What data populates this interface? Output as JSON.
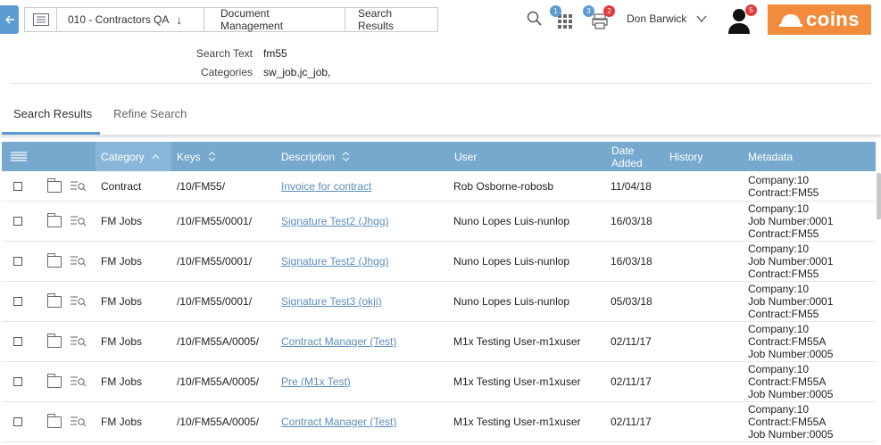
{
  "topbar": {
    "breadcrumbs": [
      {
        "label": "010 - Contractors QA",
        "arrow": "↓"
      },
      {
        "label": "Document Management"
      },
      {
        "label": "Search Results"
      }
    ],
    "badges": {
      "grid": "1",
      "notifications_blue": "3",
      "notifications_red": "2",
      "profile": "5"
    },
    "user_name": "Don Barwick",
    "logo_text": "coins"
  },
  "criteria": {
    "search_text_label": "Search Text",
    "search_text_value": "fm55",
    "categories_label": "Categories",
    "categories_value": "sw_job,jc_job,"
  },
  "tabs": [
    {
      "label": "Search Results",
      "active": true
    },
    {
      "label": "Refine Search",
      "active": false
    }
  ],
  "table": {
    "headers": {
      "category": "Category",
      "keys": "Keys",
      "description": "Description",
      "user": "User",
      "date_added_1": "Date",
      "date_added_2": "Added",
      "history": "History",
      "metadata": "Metadata"
    },
    "rows": [
      {
        "category": "Contract",
        "keys": "/10/FM55/",
        "description": "Invoice for contract",
        "user": "Rob Osborne-robosb",
        "date": "11/04/18",
        "history": "",
        "meta": [
          "Company:10",
          "Contract:FM55"
        ]
      },
      {
        "category": "FM Jobs",
        "keys": "/10/FM55/0001/",
        "description": "Signature Test2 (Jhgg)",
        "user": "Nuno Lopes Luis-nunlop",
        "date": "16/03/18",
        "history": "",
        "meta": [
          "Company:10",
          "Job Number:0001",
          "Contract:FM55"
        ]
      },
      {
        "category": "FM Jobs",
        "keys": "/10/FM55/0001/",
        "description": "Signature Test2 (Jhgg)",
        "user": "Nuno Lopes Luis-nunlop",
        "date": "16/03/18",
        "history": "",
        "meta": [
          "Company:10",
          "Job Number:0001",
          "Contract:FM55"
        ]
      },
      {
        "category": "FM Jobs",
        "keys": "/10/FM55/0001/",
        "description": "Signature Test3 (okji)",
        "user": "Nuno Lopes Luis-nunlop",
        "date": "05/03/18",
        "history": "",
        "meta": [
          "Company:10",
          "Job Number:0001",
          "Contract:FM55"
        ]
      },
      {
        "category": "FM Jobs",
        "keys": "/10/FM55A/0005/",
        "description": "Contract Manager (Test)",
        "user": "M1x Testing User-m1xuser",
        "date": "02/11/17",
        "history": "",
        "meta": [
          "Company:10",
          "Contract:FM55A",
          "Job Number:0005"
        ]
      },
      {
        "category": "FM Jobs",
        "keys": "/10/FM55A/0005/",
        "description": "Pre (M1x Test)",
        "user": "M1x Testing User-m1xuser",
        "date": "02/11/17",
        "history": "",
        "meta": [
          "Company:10",
          "Contract:FM55A",
          "Job Number:0005"
        ]
      },
      {
        "category": "FM Jobs",
        "keys": "/10/FM55A/0005/",
        "description": "Contract Manager (Test)",
        "user": "M1x Testing User-m1xuser",
        "date": "02/11/17",
        "history": "",
        "meta": [
          "Company:10",
          "Contract:FM55A",
          "Job Number:0005"
        ]
      }
    ]
  },
  "colors": {
    "accent": "#5b9bd1",
    "header_bg": "#77a9cf",
    "brand": "#f38b3c",
    "badge_blue": "#5b9bd1",
    "badge_red": "#e03b3b"
  }
}
